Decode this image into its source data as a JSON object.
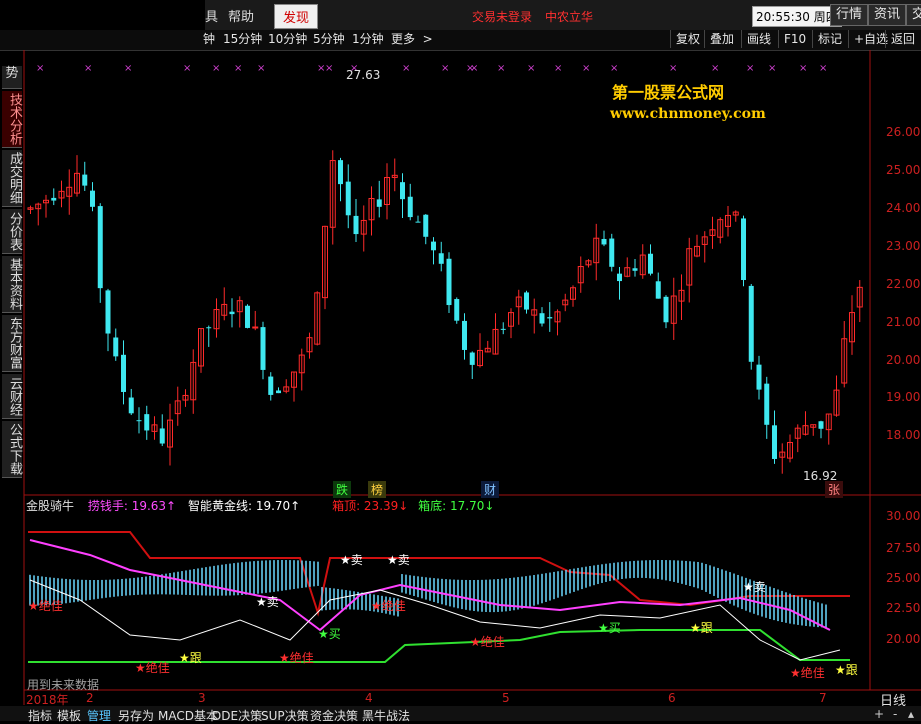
{
  "top_menu": {
    "partial_left": "具",
    "help": "帮助",
    "discover": "发现"
  },
  "status": {
    "login": "交易未登录",
    "stock_name": "中农立华"
  },
  "clock": {
    "time": "20:55:30",
    "weekday": "周四"
  },
  "top_buttons": [
    "行情",
    "资讯",
    "交易"
  ],
  "periods": [
    "钟",
    "15分钟",
    "10分钟",
    "5分钟",
    "1分钟",
    "更多"
  ],
  "toolbar_buttons": [
    "复权",
    "叠加",
    "画线",
    "F10",
    "标记",
    "+自选",
    "返回"
  ],
  "sidebar_tabs": [
    "势",
    "技术分析",
    "成交明细",
    "分价表",
    "基本资料",
    "东方财富",
    "云财经",
    "公式下载"
  ],
  "watermark": {
    "line1": "第一股票公式网",
    "line2": "www.chnmoney.com"
  },
  "main_axis": {
    "labels": [
      "26.00",
      "25.00",
      "24.00",
      "23.00",
      "22.00",
      "21.00",
      "20.00",
      "19.00",
      "18.00"
    ]
  },
  "main_annotations": {
    "high": "27.63",
    "low": "16.92",
    "tag_die": "跌",
    "tag_bang": "榜",
    "tag_cai": "财",
    "tag_zhang": "张"
  },
  "indicator": {
    "name": "金股骑牛",
    "items": [
      {
        "label": "捞钱手: ",
        "value": "19.63↑",
        "color": "#ff4dff"
      },
      {
        "label": "智能黄金线: ",
        "value": "19.70↑",
        "color": "#ffffff"
      },
      {
        "label": "箱顶: ",
        "value": "23.39↓",
        "color": "#ff2020"
      },
      {
        "label": "箱底: ",
        "value": "17.70↓",
        "color": "#40ff40"
      }
    ],
    "axis": [
      "30.00",
      "27.50",
      "25.00",
      "22.50",
      "20.00"
    ],
    "future_note": "用到未来数据",
    "signals": [
      "★绝佳",
      "★绝佳",
      "★跟",
      "★卖",
      "★绝佳",
      "★买",
      "★卖",
      "★卖",
      "★绝佳",
      "★绝佳",
      "★买",
      "★跟",
      "★卖",
      "★绝佳",
      "★跟"
    ]
  },
  "date_axis": {
    "year": "2018年",
    "months": [
      "2",
      "3",
      "4",
      "5",
      "6",
      "7"
    ],
    "period_label": "日线"
  },
  "bottom_tabs": [
    "指标",
    "模板",
    "管理",
    "另存为",
    "MACD基本",
    "DDE决策",
    "SUP决策",
    "资金决策",
    "黑牛战法"
  ],
  "bottom_active": "管理",
  "colors": {
    "up": "#ff2a2a",
    "down": "#3fe8f0",
    "axis": "#a01010",
    "accent": "#d00000"
  }
}
